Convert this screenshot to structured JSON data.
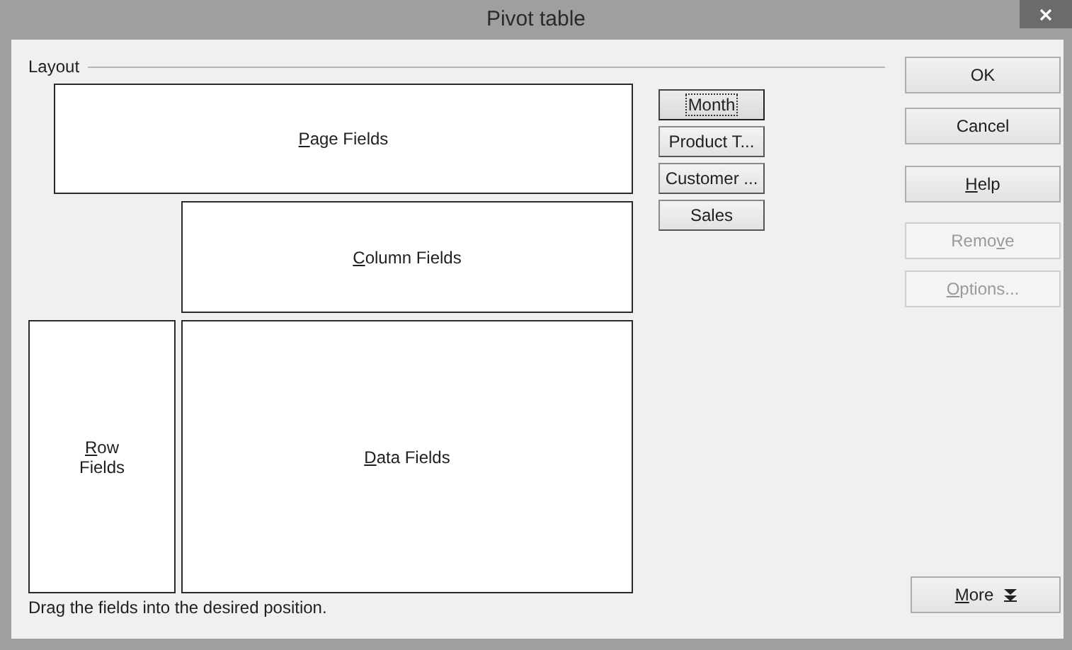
{
  "window": {
    "title": "Pivot table"
  },
  "layout": {
    "label": "Layout",
    "areas": [
      {
        "kind": "page",
        "access_key": "P",
        "text_after": "age Fields"
      },
      {
        "kind": "column",
        "access_key": "C",
        "text_after": "olumn Fields"
      },
      {
        "kind": "row",
        "access_key": "R",
        "text_after": "ow Fields"
      },
      {
        "kind": "data",
        "access_key": "D",
        "text_after": "ata Fields"
      }
    ]
  },
  "fields": [
    {
      "label": "Month",
      "focused": true
    },
    {
      "label": "Product T...",
      "focused": false
    },
    {
      "label": "Customer ...",
      "focused": false
    },
    {
      "label": "Sales",
      "focused": false
    }
  ],
  "buttons": [
    {
      "text_before": "OK",
      "disabled": false
    },
    {
      "text_before": "Cancel",
      "disabled": false
    },
    {
      "access_key": "H",
      "text_after": "elp",
      "disabled": false
    },
    {
      "text_before": "Remo",
      "access_key": "v",
      "text_after": "e",
      "disabled": true
    },
    {
      "access_key": "O",
      "text_after": "ptions...",
      "disabled": true
    }
  ],
  "more_button": {
    "access_key": "M",
    "text_after": "ore"
  },
  "hint": "Drag the fields into the desired position."
}
